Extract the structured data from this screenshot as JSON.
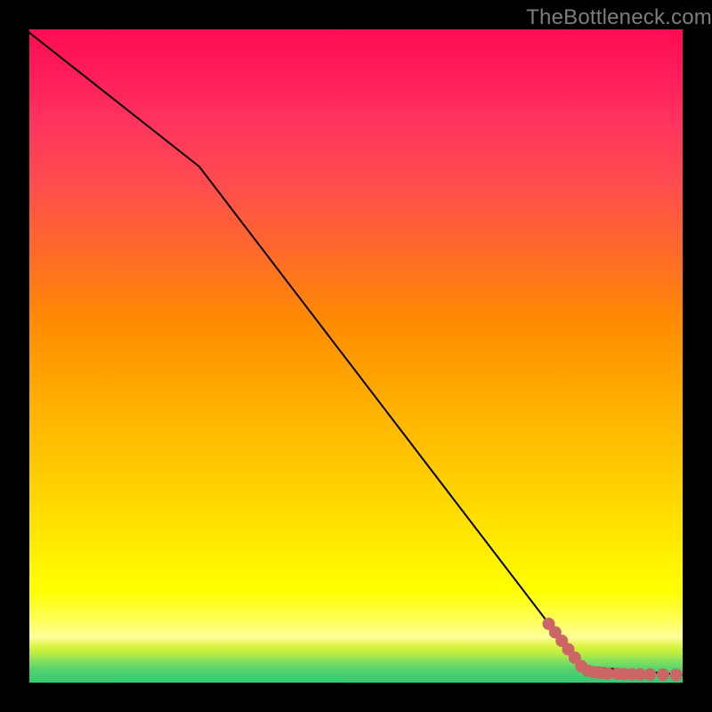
{
  "watermark": "TheBottleneck.com",
  "colors": {
    "frame": "#000000",
    "line": "#000000",
    "dot_fill": "#cc6666",
    "dot_stroke": "#cc6666"
  },
  "chart_data": {
    "type": "line",
    "title": "",
    "xlabel": "",
    "ylabel": "",
    "xlim": [
      0,
      100
    ],
    "ylim": [
      0,
      100
    ],
    "grid": false,
    "legend": false,
    "series": [
      {
        "name": "curve",
        "style": "solid",
        "x": [
          0,
          26,
          84.5,
          100
        ],
        "y": [
          99.5,
          79,
          2.5,
          1.2
        ]
      },
      {
        "name": "dots",
        "style": "points",
        "x": [
          79.5,
          80.5,
          81.5,
          82.5,
          83.5,
          84.5,
          85.5,
          86.5,
          87.5,
          88.5,
          90.0,
          91.0,
          92.2,
          93.5,
          95.0,
          97.0,
          99.0
        ],
        "y": [
          9.0,
          7.7,
          6.4,
          5.1,
          3.8,
          2.5,
          1.8,
          1.6,
          1.5,
          1.4,
          1.35,
          1.3,
          1.28,
          1.26,
          1.24,
          1.22,
          1.2
        ]
      }
    ]
  }
}
